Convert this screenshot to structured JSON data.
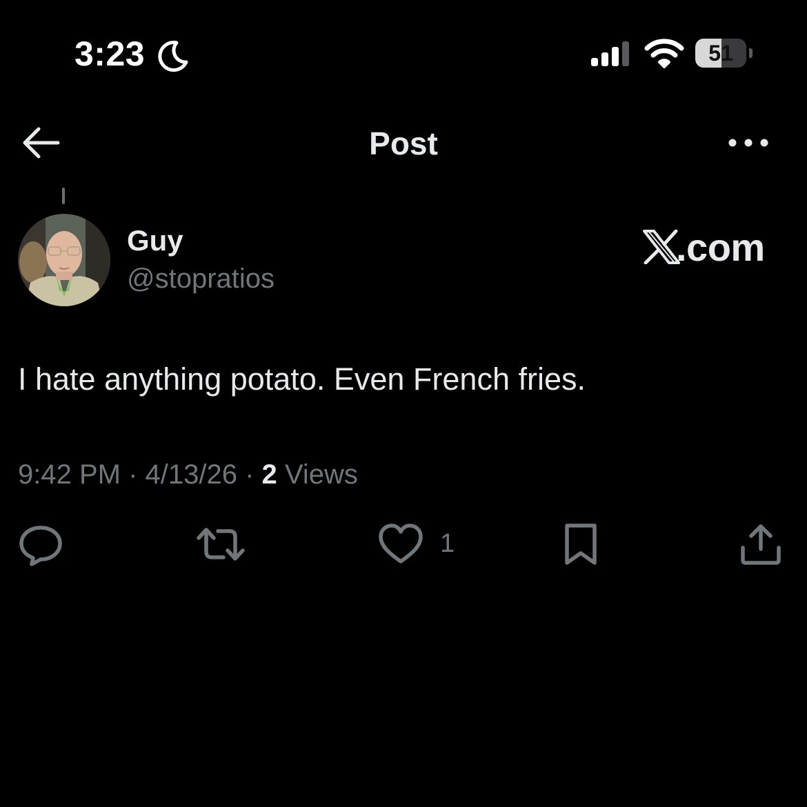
{
  "status_bar": {
    "time": "3:23",
    "battery_level": "51",
    "battery_fraction": 0.51,
    "icons": [
      "moon-icon",
      "cellular-signal-icon",
      "wifi-icon",
      "battery-icon"
    ]
  },
  "header": {
    "title": "Post",
    "back_icon": "back-arrow-icon",
    "more_icon": "more-options-icon"
  },
  "author": {
    "display_name": "Guy",
    "handle": "@stopratios"
  },
  "watermark": {
    "brand": ".com",
    "logo_icon": "x-logo-icon"
  },
  "post": {
    "text": "I hate anything potato. Even French fries."
  },
  "meta": {
    "time": "9:42 PM",
    "sep1": " · ",
    "date": "4/13/26",
    "sep2": " · ",
    "views_count": "2",
    "views_label": " Views"
  },
  "actions": {
    "reply_icon": "reply-icon",
    "repost_icon": "repost-icon",
    "like_icon": "heart-icon",
    "like_count": "1",
    "bookmark_icon": "bookmark-icon",
    "share_icon": "share-icon"
  },
  "colors": {
    "background": "#000000",
    "primary_text": "#e7e9ea",
    "secondary_text": "#71767b"
  }
}
